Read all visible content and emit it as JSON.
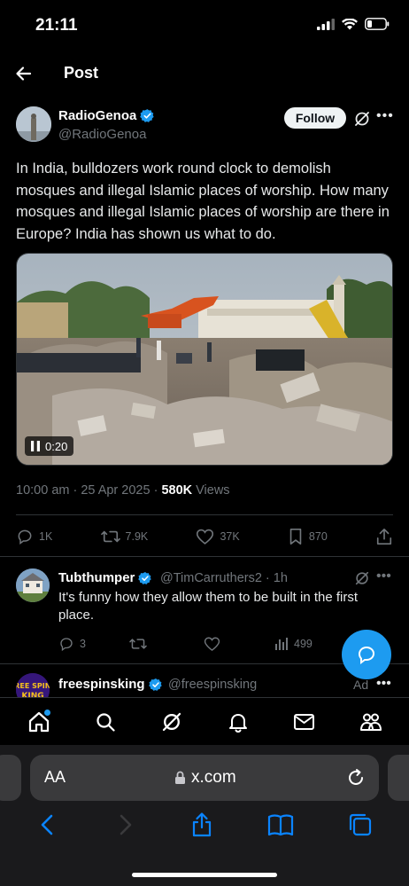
{
  "status_bar": {
    "time": "21:11"
  },
  "header": {
    "title": "Post",
    "back_icon": "arrow-left-icon"
  },
  "post": {
    "author": {
      "name": "RadioGenoa",
      "handle": "@RadioGenoa",
      "verified": true,
      "follow_label": "Follow"
    },
    "text": "In India, bulldozers work round clock to demolish mosques and illegal Islamic places of worship. How many mosques and illegal Islamic places of worship are there in Europe? India has shown us what to do.",
    "video": {
      "duration": "0:20"
    },
    "timestamp": "10:00 am · 25 Apr 2025 · ",
    "views_count": "580K",
    "views_label": " Views",
    "actions": {
      "replies": "1K",
      "reposts": "7.9K",
      "likes": "37K",
      "bookmarks": "870"
    }
  },
  "reply": {
    "name": "Tubthumper",
    "handle": "@TimCarruthers2 · 1h",
    "verified": true,
    "text": "It's funny how they allow them to be built in the first place.",
    "actions": {
      "replies": "3",
      "views": "499"
    }
  },
  "ad": {
    "name": "freespinsking",
    "handle": "@freespinsking",
    "label": "Ad",
    "avatar_text": "FREE SPINS KING"
  },
  "tabbar": [
    "home-icon",
    "search-icon",
    "grok-icon",
    "notifications-icon",
    "messages-icon",
    "communities-icon"
  ],
  "safari": {
    "aa_label": "AA",
    "url": "x.com"
  },
  "colors": {
    "accent": "#1d9bf0",
    "muted": "#71767b",
    "background": "#000000"
  }
}
